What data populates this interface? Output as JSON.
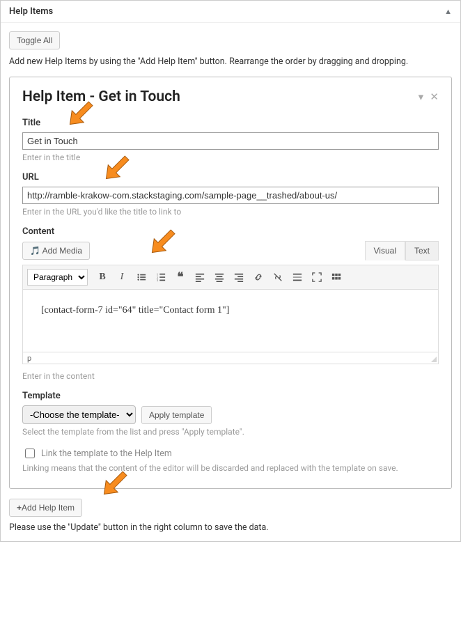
{
  "panel": {
    "title": "Help Items",
    "toggle_all": "Toggle All",
    "intro": "Add new Help Items by using the \"Add Help Item\" button. Rearrange the order by dragging and dropping."
  },
  "card": {
    "title": "Help Item - Get in Touch",
    "fields": {
      "title": {
        "label": "Title",
        "value": "Get in Touch",
        "hint": "Enter in the title"
      },
      "url": {
        "label": "URL",
        "value": "http://ramble-krakow-com.stackstaging.com/sample-page__trashed/about-us/",
        "hint": "Enter in the URL you'd like the title to link to"
      },
      "content": {
        "label": "Content",
        "add_media": "Add Media",
        "tabs": {
          "visual": "Visual",
          "text": "Text"
        },
        "format_select": "Paragraph",
        "body": "[contact-form-7 id=\"64\" title=\"Contact form 1\"]",
        "status": "p",
        "hint": "Enter in the content"
      },
      "template": {
        "label": "Template",
        "select": "-Choose the template-",
        "apply": "Apply template",
        "hint": "Select the template from the list and press \"Apply template\".",
        "link_checkbox": "Link the template to the Help Item",
        "link_hint": "Linking means that the content of the editor will be discarded and replaced with the template on save."
      }
    }
  },
  "footer": {
    "add_button": "Add Help Item",
    "note": "Please use the \"Update\" button in the right column to save the data."
  }
}
